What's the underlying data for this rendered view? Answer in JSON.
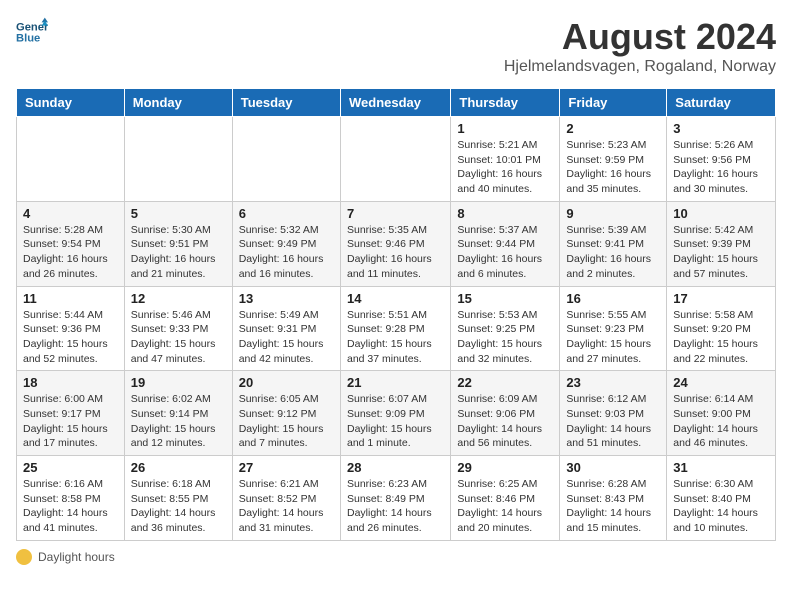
{
  "header": {
    "logo_line1": "General",
    "logo_line2": "Blue",
    "title": "August 2024",
    "subtitle": "Hjelmelandsvagen, Rogaland, Norway"
  },
  "weekdays": [
    "Sunday",
    "Monday",
    "Tuesday",
    "Wednesday",
    "Thursday",
    "Friday",
    "Saturday"
  ],
  "weeks": [
    [
      {
        "day": "",
        "info": ""
      },
      {
        "day": "",
        "info": ""
      },
      {
        "day": "",
        "info": ""
      },
      {
        "day": "",
        "info": ""
      },
      {
        "day": "1",
        "info": "Sunrise: 5:21 AM\nSunset: 10:01 PM\nDaylight: 16 hours\nand 40 minutes."
      },
      {
        "day": "2",
        "info": "Sunrise: 5:23 AM\nSunset: 9:59 PM\nDaylight: 16 hours\nand 35 minutes."
      },
      {
        "day": "3",
        "info": "Sunrise: 5:26 AM\nSunset: 9:56 PM\nDaylight: 16 hours\nand 30 minutes."
      }
    ],
    [
      {
        "day": "4",
        "info": "Sunrise: 5:28 AM\nSunset: 9:54 PM\nDaylight: 16 hours\nand 26 minutes."
      },
      {
        "day": "5",
        "info": "Sunrise: 5:30 AM\nSunset: 9:51 PM\nDaylight: 16 hours\nand 21 minutes."
      },
      {
        "day": "6",
        "info": "Sunrise: 5:32 AM\nSunset: 9:49 PM\nDaylight: 16 hours\nand 16 minutes."
      },
      {
        "day": "7",
        "info": "Sunrise: 5:35 AM\nSunset: 9:46 PM\nDaylight: 16 hours\nand 11 minutes."
      },
      {
        "day": "8",
        "info": "Sunrise: 5:37 AM\nSunset: 9:44 PM\nDaylight: 16 hours\nand 6 minutes."
      },
      {
        "day": "9",
        "info": "Sunrise: 5:39 AM\nSunset: 9:41 PM\nDaylight: 16 hours\nand 2 minutes."
      },
      {
        "day": "10",
        "info": "Sunrise: 5:42 AM\nSunset: 9:39 PM\nDaylight: 15 hours\nand 57 minutes."
      }
    ],
    [
      {
        "day": "11",
        "info": "Sunrise: 5:44 AM\nSunset: 9:36 PM\nDaylight: 15 hours\nand 52 minutes."
      },
      {
        "day": "12",
        "info": "Sunrise: 5:46 AM\nSunset: 9:33 PM\nDaylight: 15 hours\nand 47 minutes."
      },
      {
        "day": "13",
        "info": "Sunrise: 5:49 AM\nSunset: 9:31 PM\nDaylight: 15 hours\nand 42 minutes."
      },
      {
        "day": "14",
        "info": "Sunrise: 5:51 AM\nSunset: 9:28 PM\nDaylight: 15 hours\nand 37 minutes."
      },
      {
        "day": "15",
        "info": "Sunrise: 5:53 AM\nSunset: 9:25 PM\nDaylight: 15 hours\nand 32 minutes."
      },
      {
        "day": "16",
        "info": "Sunrise: 5:55 AM\nSunset: 9:23 PM\nDaylight: 15 hours\nand 27 minutes."
      },
      {
        "day": "17",
        "info": "Sunrise: 5:58 AM\nSunset: 9:20 PM\nDaylight: 15 hours\nand 22 minutes."
      }
    ],
    [
      {
        "day": "18",
        "info": "Sunrise: 6:00 AM\nSunset: 9:17 PM\nDaylight: 15 hours\nand 17 minutes."
      },
      {
        "day": "19",
        "info": "Sunrise: 6:02 AM\nSunset: 9:14 PM\nDaylight: 15 hours\nand 12 minutes."
      },
      {
        "day": "20",
        "info": "Sunrise: 6:05 AM\nSunset: 9:12 PM\nDaylight: 15 hours\nand 7 minutes."
      },
      {
        "day": "21",
        "info": "Sunrise: 6:07 AM\nSunset: 9:09 PM\nDaylight: 15 hours\nand 1 minute."
      },
      {
        "day": "22",
        "info": "Sunrise: 6:09 AM\nSunset: 9:06 PM\nDaylight: 14 hours\nand 56 minutes."
      },
      {
        "day": "23",
        "info": "Sunrise: 6:12 AM\nSunset: 9:03 PM\nDaylight: 14 hours\nand 51 minutes."
      },
      {
        "day": "24",
        "info": "Sunrise: 6:14 AM\nSunset: 9:00 PM\nDaylight: 14 hours\nand 46 minutes."
      }
    ],
    [
      {
        "day": "25",
        "info": "Sunrise: 6:16 AM\nSunset: 8:58 PM\nDaylight: 14 hours\nand 41 minutes."
      },
      {
        "day": "26",
        "info": "Sunrise: 6:18 AM\nSunset: 8:55 PM\nDaylight: 14 hours\nand 36 minutes."
      },
      {
        "day": "27",
        "info": "Sunrise: 6:21 AM\nSunset: 8:52 PM\nDaylight: 14 hours\nand 31 minutes."
      },
      {
        "day": "28",
        "info": "Sunrise: 6:23 AM\nSunset: 8:49 PM\nDaylight: 14 hours\nand 26 minutes."
      },
      {
        "day": "29",
        "info": "Sunrise: 6:25 AM\nSunset: 8:46 PM\nDaylight: 14 hours\nand 20 minutes."
      },
      {
        "day": "30",
        "info": "Sunrise: 6:28 AM\nSunset: 8:43 PM\nDaylight: 14 hours\nand 15 minutes."
      },
      {
        "day": "31",
        "info": "Sunrise: 6:30 AM\nSunset: 8:40 PM\nDaylight: 14 hours\nand 10 minutes."
      }
    ]
  ],
  "footer": {
    "label": "Daylight hours"
  }
}
